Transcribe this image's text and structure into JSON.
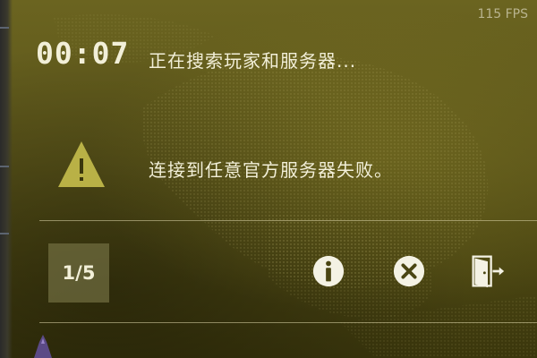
{
  "hud": {
    "fps": "115 FPS"
  },
  "matchmaking": {
    "elapsed_time": "00:07",
    "status_text": "正在搜索玩家和服务器...",
    "error_icon": "warning-triangle-icon",
    "error_text": "连接到任意官方服务器失败。",
    "page_counter": "1/5"
  },
  "actions": {
    "info_icon": "info-icon",
    "cancel_icon": "close-circle-icon",
    "exit_icon": "exit-door-icon"
  },
  "colors": {
    "background": "#5a5419",
    "text": "#f2efd8",
    "warning_triangle": "#b9b146",
    "divider": "#d8d2a6"
  }
}
